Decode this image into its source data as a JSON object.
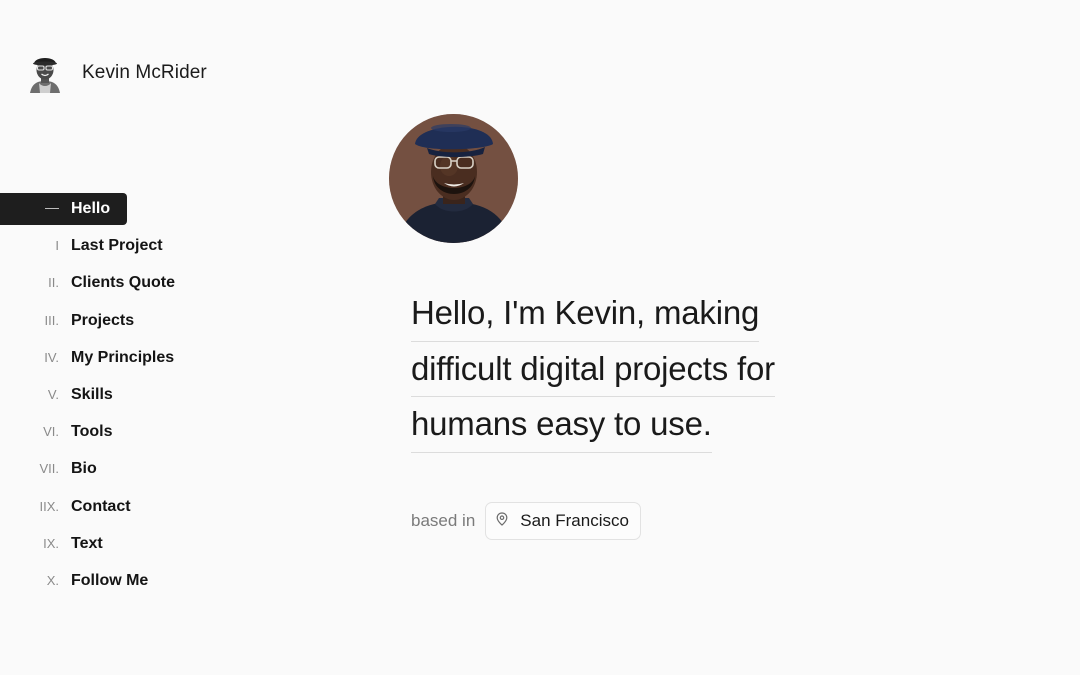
{
  "brand": {
    "name": "Kevin McRider"
  },
  "nav": {
    "items": [
      {
        "num": "",
        "label": "Hello",
        "active": true
      },
      {
        "num": "I",
        "label": "Last Project"
      },
      {
        "num": "II.",
        "label": "Clients Quote"
      },
      {
        "num": "III.",
        "label": "Projects"
      },
      {
        "num": "IV.",
        "label": "My Principles"
      },
      {
        "num": "V.",
        "label": "Skills"
      },
      {
        "num": "VI.",
        "label": "Tools"
      },
      {
        "num": "VII.",
        "label": "Bio"
      },
      {
        "num": "IIX.",
        "label": "Contact"
      },
      {
        "num": "IX.",
        "label": "Text"
      },
      {
        "num": "X.",
        "label": "Follow Me"
      }
    ]
  },
  "hero": {
    "headline_lines": [
      "Hello, I'm Kevin, making",
      "difficult digital projects for",
      "humans easy to use."
    ],
    "based_label": "based in",
    "location": "San Francisco",
    "location_icon": "map-pin-icon"
  },
  "colors": {
    "background": "#fafafa",
    "active_nav": "#1e1e1e",
    "text": "#141414",
    "muted": "#8a8a8a"
  }
}
